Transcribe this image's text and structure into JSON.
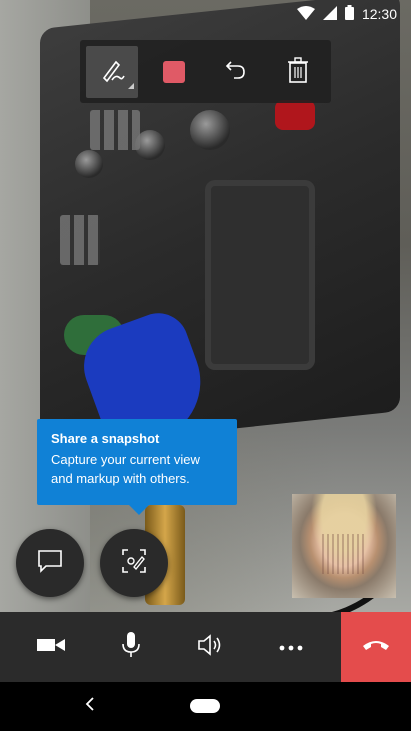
{
  "status_bar": {
    "time": "12:30",
    "icons": [
      "wifi-icon",
      "cellular-icon",
      "battery-icon"
    ]
  },
  "markup_toolbar": {
    "tools": [
      "pen-icon",
      "color-swatch",
      "undo-icon",
      "trash-icon"
    ],
    "selected_tool": "pen-icon",
    "swatch_color": "#e05a66"
  },
  "tooltip": {
    "title": "Share a snapshot",
    "body": "Capture your current view and markup with others."
  },
  "floating_buttons": [
    "chat-icon",
    "snapshot-markup-icon"
  ],
  "call_controls": [
    "video-icon",
    "microphone-icon",
    "speaker-icon",
    "more-icon",
    "hang-up-icon"
  ],
  "colors": {
    "accent": "#1081d6",
    "hangup": "#e44c4c",
    "toolbar_bg": "#202020",
    "callbar_bg": "#2b2b2b"
  },
  "nav_bar": [
    "back-icon",
    "home-pill"
  ]
}
